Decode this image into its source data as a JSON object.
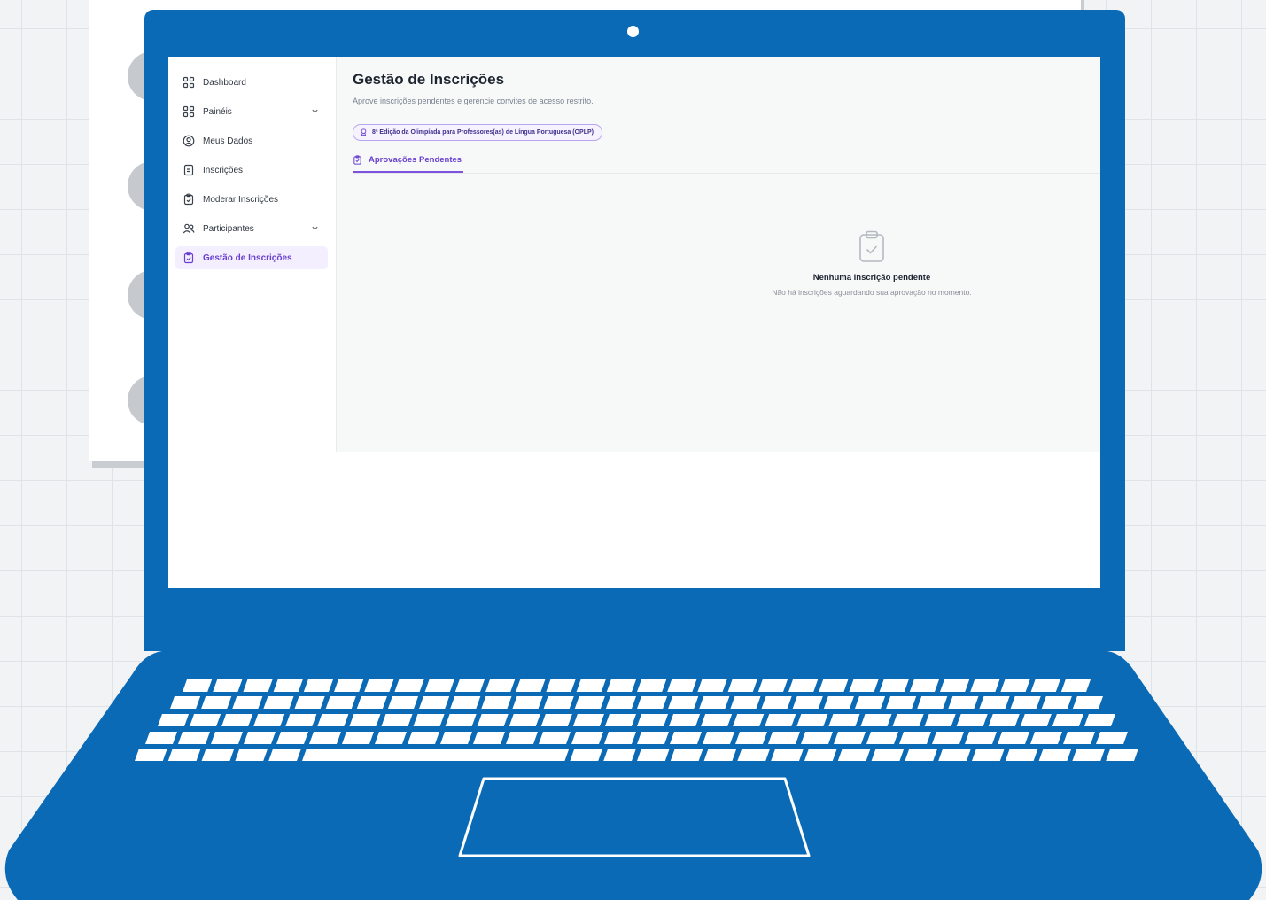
{
  "sidebar": {
    "items": [
      {
        "label": "Dashboard",
        "icon": "grid-icon"
      },
      {
        "label": "Painéis",
        "icon": "grid-icon",
        "expandable": true
      },
      {
        "label": "Meus Dados",
        "icon": "user-circle-icon"
      },
      {
        "label": "Inscrições",
        "icon": "file-icon"
      },
      {
        "label": "Moderar Inscrições",
        "icon": "clipboard-check-icon"
      },
      {
        "label": "Participantes",
        "icon": "users-icon",
        "expandable": true
      },
      {
        "label": "Gestão de Inscrições",
        "icon": "clipboard-check-icon",
        "active": true
      }
    ]
  },
  "page": {
    "title": "Gestão de Inscrições",
    "subtitle": "Aprove inscrições pendentes e gerencie convites de acesso restrito.",
    "edition": "8ª Edição da Olimpíada para Professores(as) de Língua Portuguesa (OPLP)",
    "tab_label": "Aprovações Pendentes"
  },
  "empty_state": {
    "title": "Nenhuma inscrição pendente",
    "description": "Não há inscrições aguardando sua aprovação no momento."
  },
  "colors": {
    "laptop_blue": "#0a6ab5",
    "accent_purple": "#6a3fd1",
    "annotation_arrow": "#1fd11f"
  }
}
